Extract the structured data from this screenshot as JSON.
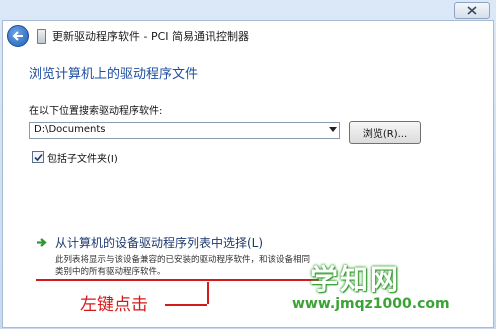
{
  "window": {
    "title": "更新驱动程序软件 - PCI 简易通讯控制器"
  },
  "page": {
    "heading": "浏览计算机上的驱动程序文件",
    "location_label": "在以下位置搜索驱动程序软件:",
    "path_value": "D:\\Documents",
    "browse_label": "浏览(R)...",
    "include_subfolders_label": "包括子文件夹(I)",
    "include_subfolders_checked": true,
    "choose_link": "从计算机的设备驱动程序列表中选择(L)",
    "choose_desc": "此列表将显示与该设备兼容的已安装的驱动程序软件，和该设备相同类别中的所有驱动程序软件。"
  },
  "annotation": {
    "text": "左键点击",
    "color": "#d41a1a"
  },
  "watermark": {
    "name": "学知网",
    "url": "www.jmqz1000.com",
    "color": "#3aa335"
  },
  "icons": [
    "back-arrow-icon",
    "device-icon",
    "checkmark-icon",
    "green-arrow-icon",
    "close-icon"
  ]
}
